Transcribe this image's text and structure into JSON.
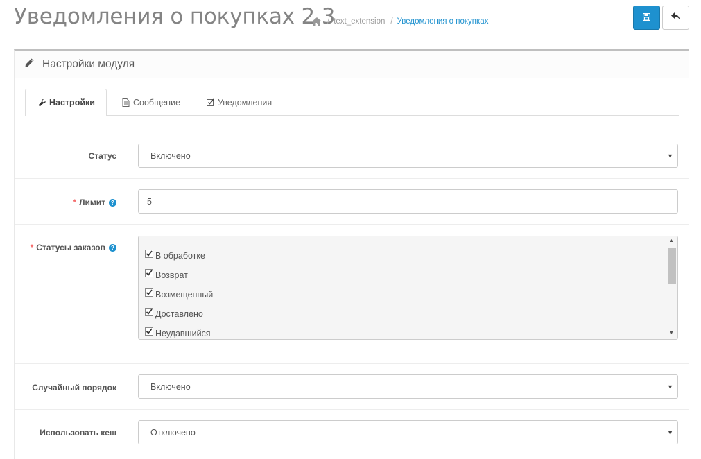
{
  "header": {
    "title": "Уведомления о покупках 2.3",
    "breadcrumb": [
      {
        "label": "text_extension"
      },
      {
        "label": "Уведомления о покупках"
      }
    ],
    "save_icon": "save-icon",
    "back_icon": "reply-icon"
  },
  "panel": {
    "title": "Настройки модуля",
    "title_icon": "pencil-icon"
  },
  "tabs": [
    {
      "label": "Настройки",
      "icon": "wrench-icon",
      "active": true
    },
    {
      "label": "Сообщение",
      "icon": "document-icon",
      "active": false
    },
    {
      "label": "Уведомления",
      "icon": "check-square-icon",
      "active": false
    }
  ],
  "form": {
    "status": {
      "label": "Статус",
      "value": "Включено"
    },
    "limit": {
      "label": "Лимит",
      "required": "*",
      "help": "?",
      "value": "5"
    },
    "order_statuses": {
      "label": "Статусы заказов",
      "required": "*",
      "help": "?",
      "options": [
        {
          "label": "В обработке",
          "checked": true
        },
        {
          "label": "Возврат",
          "checked": true
        },
        {
          "label": "Возмещенный",
          "checked": true
        },
        {
          "label": "Доставлено",
          "checked": true
        },
        {
          "label": "Неудавшийся",
          "checked": true
        }
      ]
    },
    "random_order": {
      "label": "Случайный порядок",
      "value": "Включено"
    },
    "use_cache": {
      "label": "Использовать кеш",
      "value": "Отключено"
    }
  },
  "colors": {
    "primary": "#1e91cf",
    "required": "#f56b6b"
  }
}
